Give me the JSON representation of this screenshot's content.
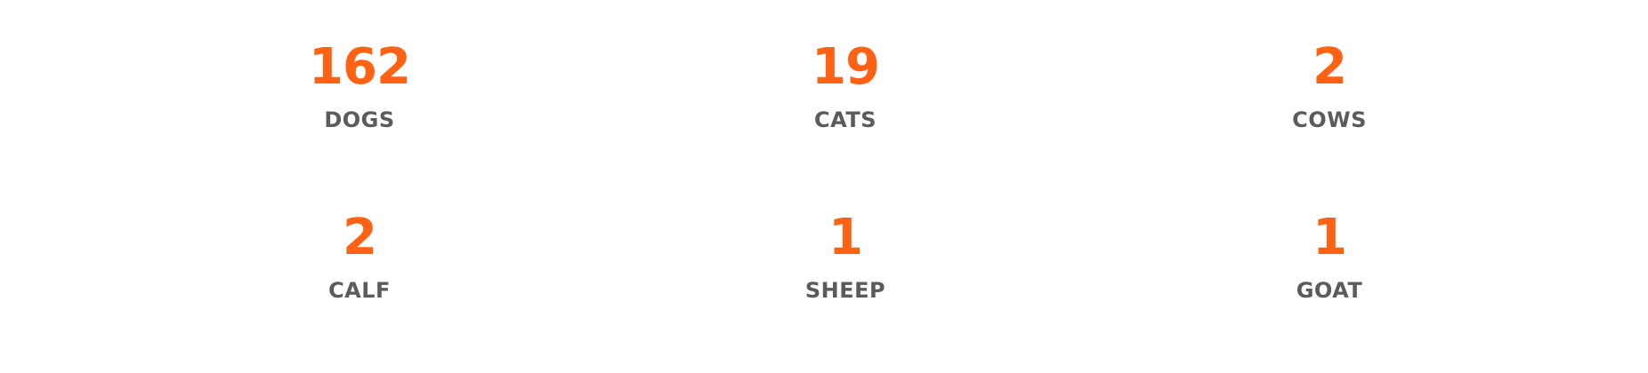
{
  "colors": {
    "accent": "#ff6213",
    "label": "#5b5b5b",
    "background": "#ffffff"
  },
  "stats": [
    {
      "value": "162",
      "label": "DOGS"
    },
    {
      "value": "19",
      "label": "CATS"
    },
    {
      "value": "2",
      "label": "COWS"
    },
    {
      "value": "2",
      "label": "CALF"
    },
    {
      "value": "1",
      "label": "SHEEP"
    },
    {
      "value": "1",
      "label": "GOAT"
    }
  ]
}
